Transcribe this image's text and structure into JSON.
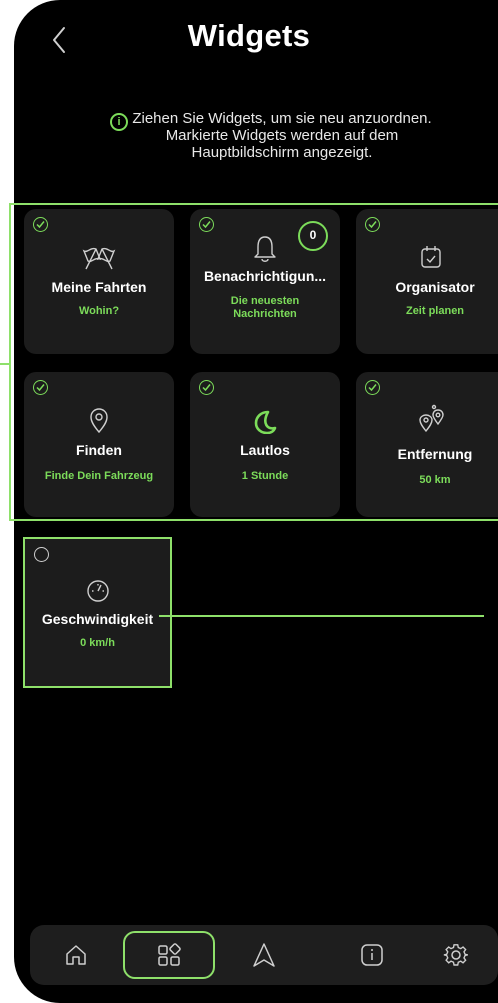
{
  "header": {
    "title": "Widgets",
    "back_icon": "chevron-left-icon"
  },
  "hint": {
    "icon": "info-icon",
    "icon_glyph": "i",
    "text": "Ziehen Sie Widgets, um sie neu anzuordnen. Markierte Widgets werden auf dem Hauptbildschirm angezeigt."
  },
  "colors": {
    "accent": "#7cdc5a",
    "frame": "#8ee06a",
    "tile": "#1c1c1c",
    "background": "#000000"
  },
  "widgets": [
    {
      "name": "Meine Fahrten",
      "sub": "Wohin?",
      "icon": "racing-flags-icon",
      "selected": true
    },
    {
      "name": "Benachrichtigun...",
      "sub": "Die neuesten Nachrichten",
      "icon": "bell-icon",
      "selected": true,
      "badge": "0"
    },
    {
      "name": "Organisator",
      "sub": "Zeit planen",
      "icon": "calendar-check-icon",
      "selected": true
    },
    {
      "name": "Finden",
      "sub": "Finde Dein Fahrzeug",
      "icon": "location-pin-icon",
      "selected": true
    },
    {
      "name": "Lautlos",
      "sub": "1 Stunde",
      "icon": "moon-icon",
      "selected": true
    },
    {
      "name": "Entfernung",
      "sub": "50 km",
      "icon": "route-pins-icon",
      "selected": true
    },
    {
      "name": "Geschwindigkeit",
      "sub": "0 km/h",
      "icon": "speedometer-icon",
      "selected": false
    }
  ],
  "nav": [
    {
      "label": "home",
      "icon": "home-icon",
      "active": false
    },
    {
      "label": "widgets",
      "icon": "widgets-grid-icon",
      "active": true
    },
    {
      "label": "navigation",
      "icon": "navigation-arrow-icon",
      "active": false
    },
    {
      "label": "info",
      "icon": "info-icon",
      "active": false
    },
    {
      "label": "settings",
      "icon": "gear-icon",
      "active": false
    }
  ]
}
